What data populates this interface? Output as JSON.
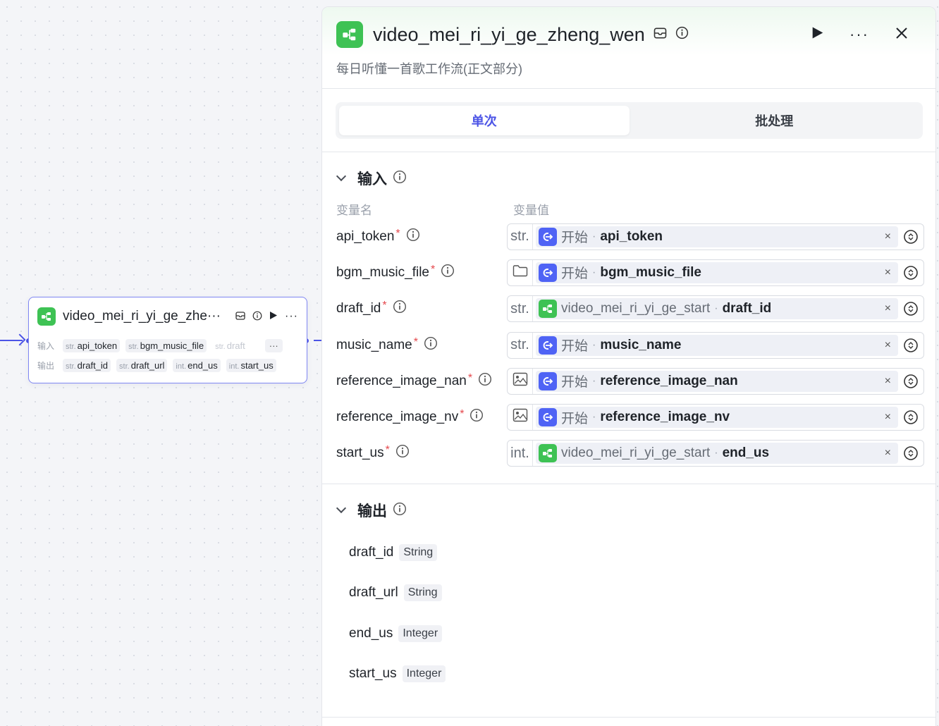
{
  "node": {
    "title": "video_mei_ri_yi_ge_zhe···",
    "more": "···",
    "inputs_label": "输入",
    "outputs_label": "输出",
    "inputs": [
      {
        "type": "str.",
        "name": "api_token"
      },
      {
        "type": "str.",
        "name": "bgm_music_file"
      },
      {
        "type": "str.",
        "name": "draft"
      }
    ],
    "inputs_more": "···",
    "outputs": [
      {
        "type": "str.",
        "name": "draft_id"
      },
      {
        "type": "str.",
        "name": "draft_url"
      },
      {
        "type": "int.",
        "name": "end_us"
      },
      {
        "type": "int.",
        "name": "start_us"
      }
    ]
  },
  "panel": {
    "title": "video_mei_ri_yi_ge_zheng_wen",
    "description": "每日听懂一首歌工作流(正文部分)",
    "more": "···",
    "tabs": {
      "single": "单次",
      "batch": "批处理"
    },
    "inputs_title": "输入",
    "col_name": "变量名",
    "col_value": "变量值",
    "inputs": [
      {
        "name": "api_token",
        "req": "*",
        "type": "str.",
        "source": "开始",
        "src_kind": "start",
        "var": "api_token",
        "sep": "·"
      },
      {
        "name": "bgm_music_file",
        "req": "*",
        "type": "",
        "type_icon": "folder",
        "source": "开始",
        "src_kind": "start",
        "var": "bgm_music_file",
        "sep": "·"
      },
      {
        "name": "draft_id",
        "req": "*",
        "type": "str.",
        "source": "video_mei_ri_yi_ge_start",
        "src_kind": "node",
        "var": "draft_id",
        "sep": "·"
      },
      {
        "name": "music_name",
        "req": "*",
        "type": "str.",
        "source": "开始",
        "src_kind": "start",
        "var": "music_name",
        "sep": "·"
      },
      {
        "name": "reference_image_nan",
        "req": "*",
        "type": "",
        "type_icon": "image",
        "source": "开始",
        "src_kind": "start",
        "var": "reference_image_nan",
        "sep": "·"
      },
      {
        "name": "reference_image_nv",
        "req": "*",
        "type": "",
        "type_icon": "image",
        "source": "开始",
        "src_kind": "start",
        "var": "reference_image_nv",
        "sep": "·"
      },
      {
        "name": "start_us",
        "req": "*",
        "type": "int.",
        "source": "video_mei_ri_yi_ge_start",
        "src_kind": "node",
        "var": "end_us",
        "sep": "·"
      }
    ],
    "clear": "×",
    "outputs_title": "输出",
    "outputs": [
      {
        "name": "draft_id",
        "type": "String"
      },
      {
        "name": "draft_url",
        "type": "String"
      },
      {
        "name": "end_us",
        "type": "Integer"
      },
      {
        "name": "start_us",
        "type": "Integer"
      }
    ]
  },
  "colors": {
    "accent": "#4c54e6",
    "node_green": "#3ec254",
    "start_blue": "#4f63f5",
    "required": "#e5484d"
  }
}
